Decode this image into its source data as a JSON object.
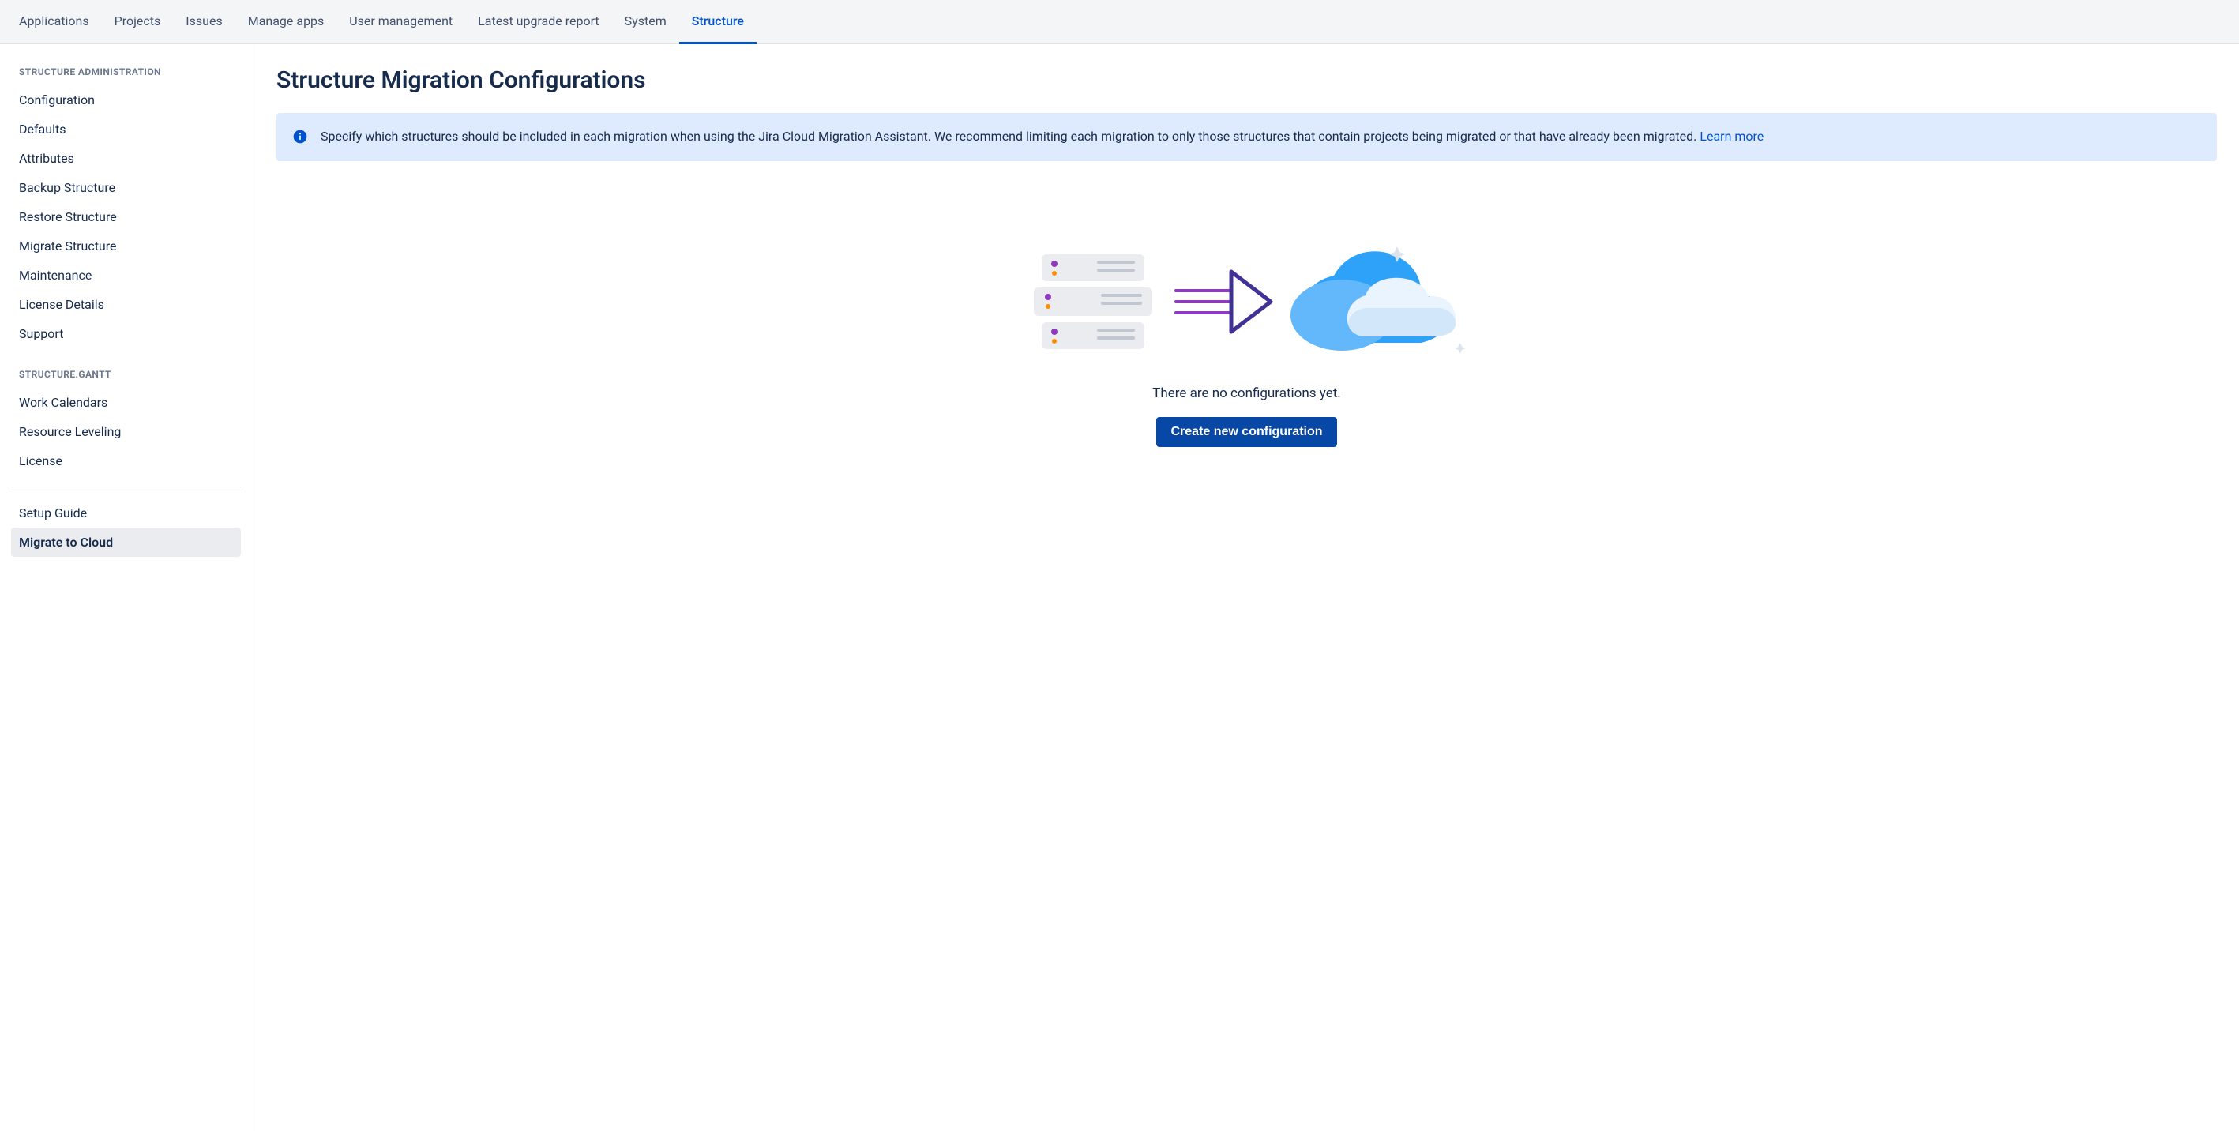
{
  "topnav": {
    "items": [
      {
        "label": "Applications",
        "active": false
      },
      {
        "label": "Projects",
        "active": false
      },
      {
        "label": "Issues",
        "active": false
      },
      {
        "label": "Manage apps",
        "active": false
      },
      {
        "label": "User management",
        "active": false
      },
      {
        "label": "Latest upgrade report",
        "active": false
      },
      {
        "label": "System",
        "active": false
      },
      {
        "label": "Structure",
        "active": true
      }
    ]
  },
  "sidebar": {
    "sections": [
      {
        "heading": "STRUCTURE ADMINISTRATION",
        "items": [
          {
            "label": "Configuration",
            "selected": false
          },
          {
            "label": "Defaults",
            "selected": false
          },
          {
            "label": "Attributes",
            "selected": false
          },
          {
            "label": "Backup Structure",
            "selected": false
          },
          {
            "label": "Restore Structure",
            "selected": false
          },
          {
            "label": "Migrate Structure",
            "selected": false
          },
          {
            "label": "Maintenance",
            "selected": false
          },
          {
            "label": "License Details",
            "selected": false
          },
          {
            "label": "Support",
            "selected": false
          }
        ]
      },
      {
        "heading": "STRUCTURE.GANTT",
        "items": [
          {
            "label": "Work Calendars",
            "selected": false
          },
          {
            "label": "Resource Leveling",
            "selected": false
          },
          {
            "label": "License",
            "selected": false
          }
        ]
      },
      {
        "heading": null,
        "divider": true,
        "items": [
          {
            "label": "Setup Guide",
            "selected": false
          },
          {
            "label": "Migrate to Cloud",
            "selected": true
          }
        ]
      }
    ]
  },
  "main": {
    "title": "Structure Migration Configurations",
    "info": {
      "text": "Specify which structures should be included in each migration when using the Jira Cloud Migration Assistant. We recommend limiting each migration to only those structures that contain projects being migrated or that have already been migrated. ",
      "link_label": "Learn more"
    },
    "empty": {
      "message": "There are no configurations yet.",
      "button_label": "Create new configuration"
    }
  }
}
